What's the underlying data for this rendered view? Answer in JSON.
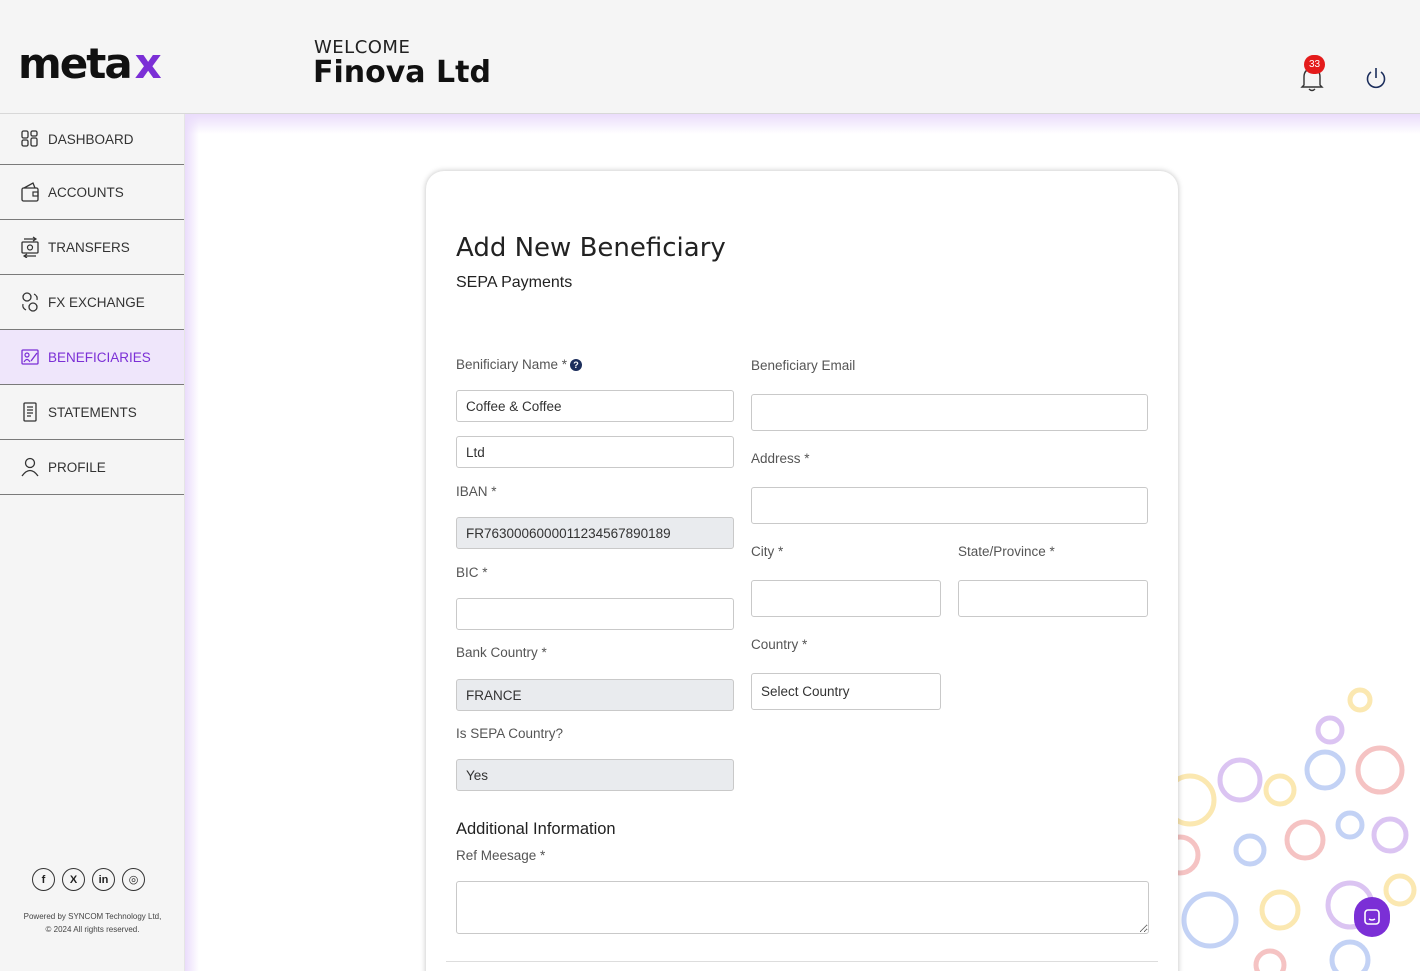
{
  "brand": {
    "logo_text": "meta",
    "logo_accent": "x",
    "accent_color": "#7b2fd6"
  },
  "header": {
    "welcome": "WELCOME",
    "company": "Finova Ltd",
    "notification_count": "33"
  },
  "sidebar": {
    "items": [
      {
        "label": "DASHBOARD",
        "icon": "dashboard-icon"
      },
      {
        "label": "ACCOUNTS",
        "icon": "wallet-icon"
      },
      {
        "label": "TRANSFERS",
        "icon": "transfer-icon"
      },
      {
        "label": "FX EXCHANGE",
        "icon": "exchange-icon"
      },
      {
        "label": "BENEFICIARIES",
        "icon": "beneficiaries-icon",
        "active": true
      },
      {
        "label": "STATEMENTS",
        "icon": "statement-icon"
      },
      {
        "label": "PROFILE",
        "icon": "user-icon"
      }
    ],
    "social": [
      "f",
      "X",
      "in",
      "◎"
    ],
    "footer_line1": "Powered by SYNCOM Technology Ltd,",
    "footer_line2": "© 2024 All rights reserved."
  },
  "form": {
    "title": "Add New Beneficiary",
    "subtitle": "SEPA Payments",
    "name_label": "Benificiary Name *",
    "name_line1": "Coffee & Coffee",
    "name_line2": "Ltd",
    "iban_label": "IBAN *",
    "iban_value": "FR7630006000011234567890189",
    "bic_label": "BIC *",
    "bic_value": "",
    "bank_country_label": "Bank Country *",
    "bank_country_value": "FRANCE",
    "sepa_label": "Is SEPA Country?",
    "sepa_value": "Yes",
    "email_label": "Beneficiary Email",
    "email_value": "",
    "address_label": "Address *",
    "address_value": "",
    "city_label": "City *",
    "city_value": "",
    "state_label": "State/Province *",
    "state_value": "",
    "country_label": "Country *",
    "country_value": "Select Country",
    "additional_title": "Additional Information",
    "ref_label": "Ref Meesage *",
    "ref_value": ""
  }
}
